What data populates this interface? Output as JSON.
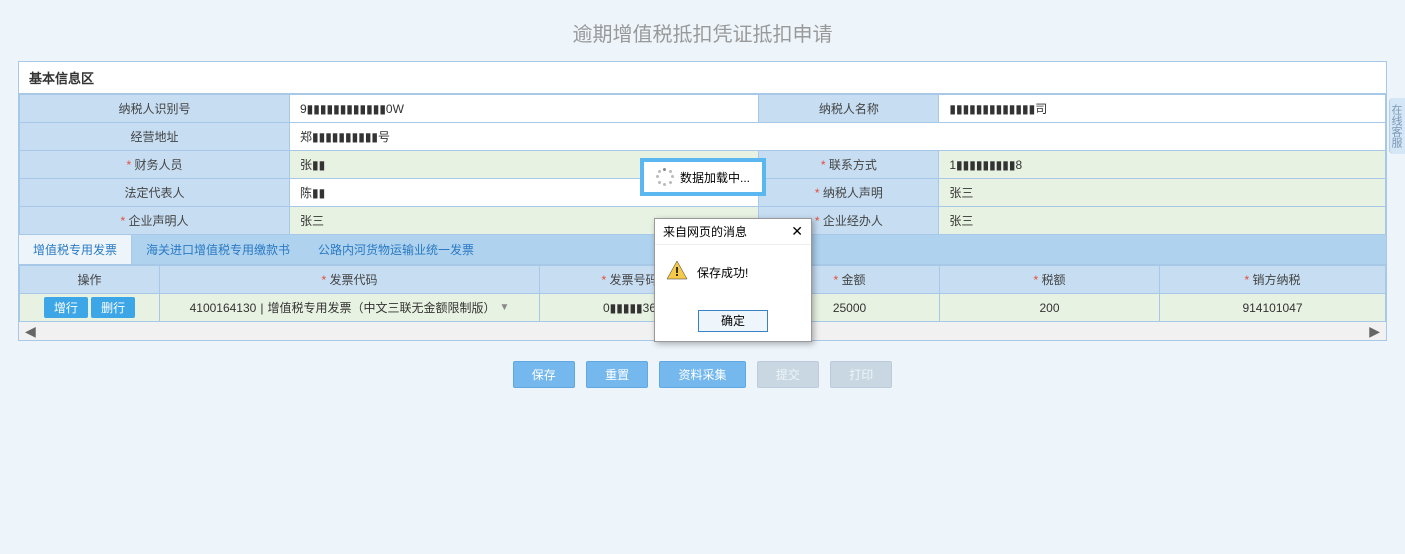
{
  "page_title": "逾期增值税抵扣凭证抵扣申请",
  "panel_title": "基本信息区",
  "info": {
    "taxpayer_id_label": "纳税人识别号",
    "taxpayer_id_value": "9▮▮▮▮▮▮▮▮▮▮▮▮0W",
    "taxpayer_name_label": "纳税人名称",
    "taxpayer_name_value": "▮▮▮▮▮▮▮▮▮▮▮▮▮司",
    "biz_addr_label": "经营地址",
    "biz_addr_value": "郑▮▮▮▮▮▮▮▮▮▮号",
    "fin_staff_label": "财务人员",
    "fin_staff_value": "张▮▮",
    "contact_label": "联系方式",
    "contact_value": "1▮▮▮▮▮▮▮▮▮8",
    "legal_rep_label": "法定代表人",
    "legal_rep_value": "陈▮▮",
    "tax_decl_label": "纳税人声明",
    "tax_decl_value": "张三",
    "corp_decl_label": "企业声明人",
    "corp_decl_value": "张三",
    "corp_handler_label": "企业经办人",
    "corp_handler_value": "张三"
  },
  "tabs": {
    "t0": "增值税专用发票",
    "t1": "海关进口增值税专用缴款书",
    "t2": "公路内河货物运输业统一发票"
  },
  "cols": {
    "op": "操作",
    "code": "发票代码",
    "no": "发票号码",
    "amount": "金额",
    "tax": "税额",
    "seller": "销方纳税"
  },
  "row": {
    "add": "增行",
    "del": "删行",
    "code_pre": "4100164130",
    "code_sel": "增值税专用发票（中文三联无金额限制版）",
    "no": "0▮▮▮▮▮36",
    "amount": "25000",
    "tax": "200",
    "seller": "914101047"
  },
  "footer": {
    "save": "保存",
    "reset": "重置",
    "collect": "资料采集",
    "b4": "提交",
    "b5": "打印"
  },
  "loading": "数据加载中...",
  "dialog": {
    "title": "来自网页的消息",
    "msg": "保存成功!",
    "ok": "确定"
  },
  "side": "在线客服"
}
